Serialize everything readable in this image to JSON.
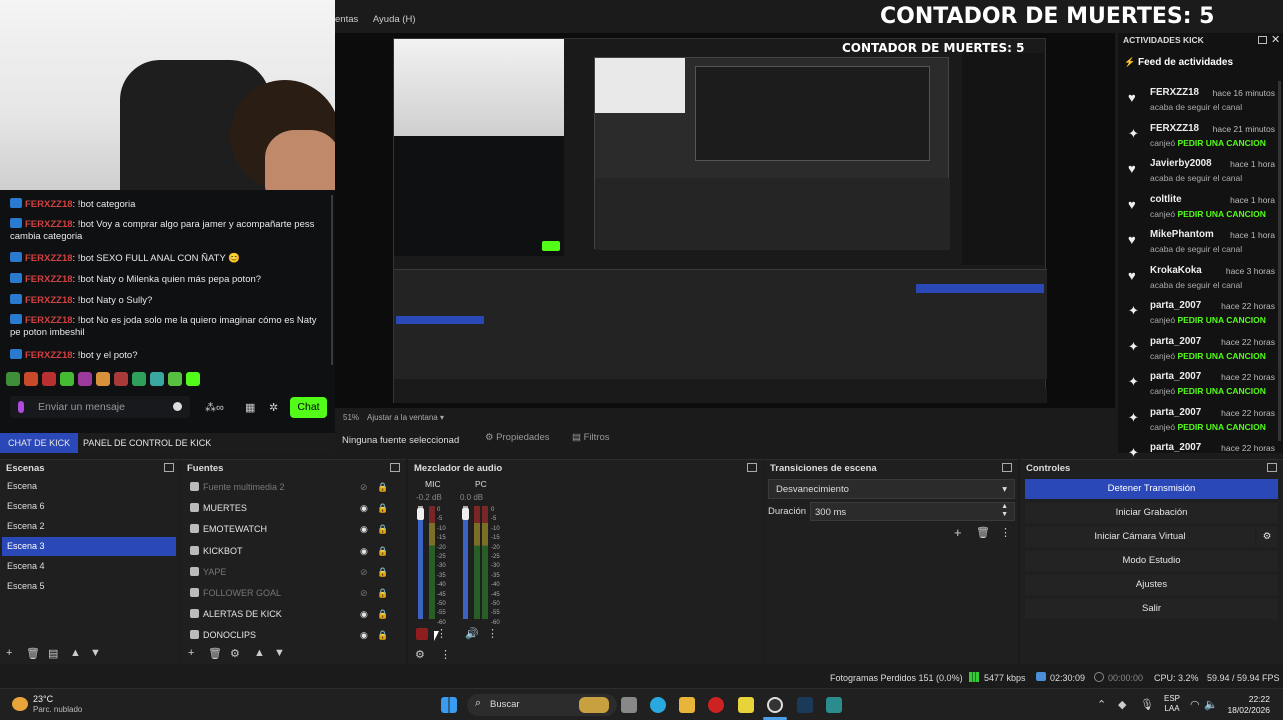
{
  "overlay": {
    "deaths_label": "CONTADOR DE MUERTES: 5",
    "deaths_label_small": "CONTADOR DE MUERTES: 5"
  },
  "menu": {
    "item1": "entas",
    "item2": "Ayuda (H)"
  },
  "chat": {
    "messages": [
      {
        "user": "FERXZZ18",
        "text": ": !bot categoria"
      },
      {
        "user": "FERXZZ18",
        "text": ": !bot Voy a comprar algo para jamer y acompañarte pess cambia categoria"
      },
      {
        "user": "FERXZZ18",
        "text": ": !bot SEXO FULL ANAL CON ÑATY 😊"
      },
      {
        "user": "FERXZZ18",
        "text": ": !bot Naty o Milenka quien más pepa poton?"
      },
      {
        "user": "FERXZZ18",
        "text": ": !bot Naty o Sully?"
      },
      {
        "user": "FERXZZ18",
        "text": ": !bot No es joda solo me la quiero imaginar cómo es Naty pe poton imbeshil"
      },
      {
        "user": "FERXZZ18",
        "text": ": !bot y el poto?"
      }
    ],
    "input_placeholder": "Enviar un mensaje",
    "send_label": "Chat",
    "tab_chat": "CHAT DE KICK",
    "tab_panel": "PANEL DE CONTROL DE KICK"
  },
  "activity": {
    "title": "ACTIVIDADES KICK",
    "feed_title": "Feed de actividades",
    "items": [
      {
        "name": "FERXZZ18",
        "time": "hace 16 minutos",
        "desc": "acaba de seguir el canal",
        "highlight": "",
        "icon": "heart"
      },
      {
        "name": "FERXZZ18",
        "time": "hace 21 minutos",
        "desc": "canjeó",
        "highlight": "PEDIR UNA CANCION",
        "icon": "redeem"
      },
      {
        "name": "Javierby2008",
        "time": "hace 1 hora",
        "desc": "acaba de seguir el canal",
        "highlight": "",
        "icon": "heart"
      },
      {
        "name": "coltlite",
        "time": "hace 1 hora",
        "desc": "canjeó",
        "highlight": "PEDIR UNA CANCION",
        "icon": "heart"
      },
      {
        "name": "MikePhantom",
        "time": "hace 1 hora",
        "desc": "acaba de seguir el canal",
        "highlight": "",
        "icon": "heart"
      },
      {
        "name": "KrokaKoka",
        "time": "hace 3 horas",
        "desc": "acaba de seguir el canal",
        "highlight": "",
        "icon": "heart"
      },
      {
        "name": "parta_2007",
        "time": "hace 22 horas",
        "desc": "canjeó",
        "highlight": "PEDIR UNA CANCION",
        "icon": "redeem"
      },
      {
        "name": "parta_2007",
        "time": "hace 22 horas",
        "desc": "canjeó",
        "highlight": "PEDIR UNA CANCION",
        "icon": "redeem"
      },
      {
        "name": "parta_2007",
        "time": "hace 22 horas",
        "desc": "canjeó",
        "highlight": "PEDIR UNA CANCION",
        "icon": "redeem"
      },
      {
        "name": "parta_2007",
        "time": "hace 22 horas",
        "desc": "canjeó",
        "highlight": "PEDIR UNA CANCION",
        "icon": "redeem"
      },
      {
        "name": "parta_2007",
        "time": "hace 22 horas",
        "desc": "",
        "highlight": "",
        "icon": "redeem"
      }
    ]
  },
  "preview_bar": {
    "zoom": "51%",
    "fit": "Ajustar a la ventana",
    "no_source": "Ninguna fuente seleccionad",
    "props": "Propiedades",
    "filters": "Filtros"
  },
  "scenes": {
    "title": "Escenas",
    "items": [
      "Escena",
      "Escena 6",
      "Escena 2",
      "Escena 3",
      "Escena 4",
      "Escena 5"
    ],
    "selected": "Escena 3"
  },
  "sources": {
    "title": "Fuentes",
    "items": [
      {
        "name": "Fuente multimedia 2",
        "dim": true
      },
      {
        "name": "MUERTES",
        "dim": false
      },
      {
        "name": "EMOTEWATCH",
        "dim": false
      },
      {
        "name": "KICKBOT",
        "dim": false
      },
      {
        "name": "YAPE",
        "dim": true
      },
      {
        "name": "FOLLOWER GOAL",
        "dim": true
      },
      {
        "name": "ALERTAS DE KICK",
        "dim": false
      },
      {
        "name": "DONOCLIPS",
        "dim": false
      }
    ]
  },
  "mixer": {
    "title": "Mezclador de audio",
    "ch1": "MIC",
    "ch1_db": "-0.2 dB",
    "ch2": "PC",
    "ch2_db": "0.0 dB",
    "scale": [
      "0",
      "-5",
      "-10",
      "-15",
      "-20",
      "-25",
      "-30",
      "-35",
      "-40",
      "-45",
      "-50",
      "-55",
      "-60"
    ]
  },
  "transitions": {
    "title": "Transiciones de escena",
    "type": "Desvanecimiento",
    "duration_label": "Duración",
    "duration": "300 ms"
  },
  "controls": {
    "title": "Controles",
    "buttons": [
      "Detener Transmisión",
      "Iniciar Grabación",
      "Iniciar Cámara Virtual",
      "Modo Estudio",
      "Ajustes",
      "Salir"
    ]
  },
  "status": {
    "dropped": "Fotogramas Perdidos 151 (0.0%)",
    "bitrate": "5477 kbps",
    "live": "02:30:09",
    "rec": "00:00:00",
    "cpu": "CPU: 3.2%",
    "fps": "59.94 / 59.94 FPS"
  },
  "taskbar": {
    "temp": "23°C",
    "weather": "Parc. nublado",
    "search": "Buscar",
    "lang1": "ESP",
    "lang2": "LAA",
    "time": "22:22",
    "date": "18/02/2026"
  },
  "colors": {
    "accent": "#2a48b8",
    "kick_green": "#53fc18",
    "chat_user": "#d24040"
  }
}
